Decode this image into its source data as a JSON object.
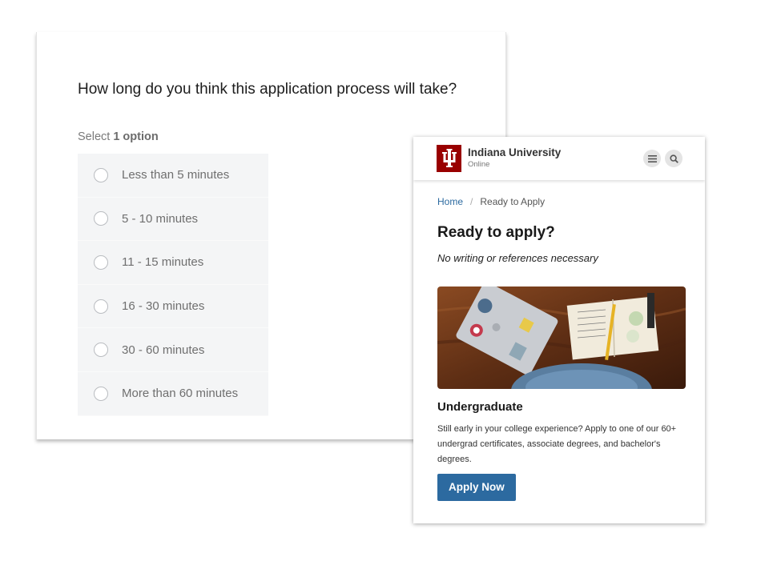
{
  "survey": {
    "question": "How long do you think this application process will take?",
    "select_prefix": "Select",
    "select_count": "1 option",
    "options": [
      "Less than 5 minutes",
      "5 - 10 minutes",
      "11 - 15 minutes",
      "16 - 30 minutes",
      "30 - 60 minutes",
      "More than 60 minutes"
    ]
  },
  "iu": {
    "brand_name": "Indiana University",
    "brand_sub": "Online",
    "header_icons": [
      "menu-icon",
      "search-icon"
    ],
    "breadcrumb": {
      "home": "Home",
      "separator": "/",
      "current": "Ready to Apply"
    },
    "title": "Ready to apply?",
    "subtitle": "No writing or references necessary",
    "section_title": "Undergraduate",
    "description": "Still early in your college experience? Apply to one of our 60+ undergrad certificates, associate degrees, and bachelor's degrees.",
    "cta": "Apply Now"
  },
  "colors": {
    "iu_crimson": "#990000",
    "link_blue": "#2c6aa0",
    "option_bg": "#f4f5f6"
  }
}
